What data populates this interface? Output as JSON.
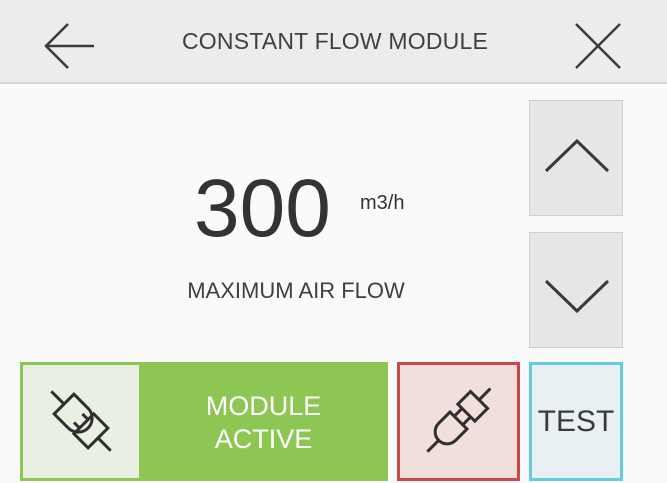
{
  "header": {
    "title": "CONSTANT FLOW MODULE",
    "back_icon": "arrow-left-icon",
    "close_icon": "close-icon"
  },
  "flow": {
    "value": "300",
    "unit": "m3/h",
    "label": "MAXIMUM AIR FLOW"
  },
  "controls": {
    "up_icon": "chevron-up-icon",
    "down_icon": "chevron-down-icon"
  },
  "module": {
    "status_line1": "MODULE",
    "status_line2": "ACTIVE",
    "connected_icon": "plug-connected-icon",
    "disconnect_icon": "plug-disconnected-icon"
  },
  "test": {
    "label": "TEST"
  },
  "colors": {
    "header_bg": "#ececec",
    "active_green": "#8dc653",
    "disconnect_border": "#c9494a",
    "test_border": "#67cbe0"
  }
}
